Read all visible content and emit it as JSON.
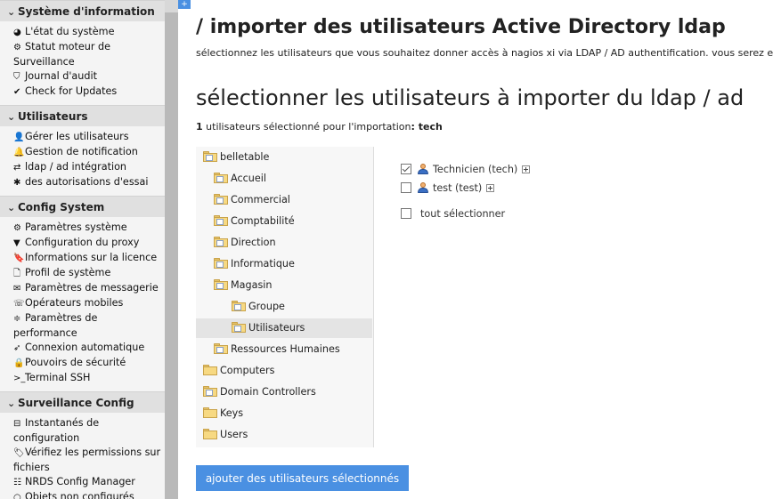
{
  "sidebar": {
    "sections": [
      {
        "title": "Système d'information",
        "items": [
          {
            "icon": "pie-chart-icon",
            "glyph": "◕",
            "label": "L'état du système"
          },
          {
            "icon": "dashboard-icon",
            "glyph": "⚙",
            "label": "Statut moteur de Surveillance"
          },
          {
            "icon": "shield-icon",
            "glyph": "⛉",
            "label": "Journal d'audit"
          },
          {
            "icon": "check-circle-icon",
            "glyph": "✔",
            "label": "Check for Updates"
          }
        ]
      },
      {
        "title": "Utilisateurs",
        "items": [
          {
            "icon": "user-icon",
            "glyph": "👤",
            "label": "Gérer les utilisateurs"
          },
          {
            "icon": "bell-icon",
            "glyph": "🔔",
            "label": "Gestion de notification"
          },
          {
            "icon": "exchange-icon",
            "glyph": "⇄",
            "label": "ldap / ad intégration"
          },
          {
            "icon": "asterisk-icon",
            "glyph": "✱",
            "label": "des autorisations d'essai"
          }
        ]
      },
      {
        "title": "Config System",
        "items": [
          {
            "icon": "cog-icon",
            "glyph": "⚙",
            "label": "Paramètres système"
          },
          {
            "icon": "filter-icon",
            "glyph": "▼",
            "label": "Configuration du proxy"
          },
          {
            "icon": "bookmark-icon",
            "glyph": "🔖",
            "label": "Informations sur la licence"
          },
          {
            "icon": "file-icon",
            "glyph": "🗋",
            "label": "Profil de système"
          },
          {
            "icon": "envelope-icon",
            "glyph": "✉",
            "label": "Paramètres de messagerie"
          },
          {
            "icon": "phone-icon",
            "glyph": "☏",
            "label": "Opérateurs mobiles"
          },
          {
            "icon": "sliders-icon",
            "glyph": "≑",
            "label": "Paramètres de performance"
          },
          {
            "icon": "paper-plane-icon",
            "glyph": "➶",
            "label": "Connexion automatique"
          },
          {
            "icon": "lock-icon",
            "glyph": "🔒",
            "label": "Pouvoirs de sécurité"
          },
          {
            "icon": "terminal-icon",
            "glyph": ">_",
            "label": "Terminal SSH"
          }
        ]
      },
      {
        "title": "Surveillance Config",
        "items": [
          {
            "icon": "hdd-icon",
            "glyph": "⊟",
            "label": "Instantanés de configuration"
          },
          {
            "icon": "tag-icon",
            "glyph": "🏷",
            "label": "Vérifiez les permissions sur fichiers"
          },
          {
            "icon": "sitemap-icon",
            "glyph": "☷",
            "label": "NRDS Config Manager"
          },
          {
            "icon": "circle-icon",
            "glyph": "○",
            "label": "Objets non configurés"
          }
        ]
      }
    ]
  },
  "main": {
    "title": "/ importer des utilisateurs Active Directory ldap",
    "description": "sélectionnez les utilisateurs que vous souhaitez donner accès à nagios xi via LDAP / AD authentification. vous serez e",
    "section_title": "sélectionner les utilisateurs à importer du ldap / ad",
    "selected_count": "1",
    "selected_text": " utilisateurs sélectionné pour l'importation",
    "selected_sep": ": ",
    "selected_names": "tech",
    "tree": [
      {
        "label": "belletable",
        "depth": 0,
        "selected": false
      },
      {
        "label": "Accueil",
        "depth": 1,
        "selected": false
      },
      {
        "label": "Commercial",
        "depth": 1,
        "selected": false
      },
      {
        "label": "Comptabilité",
        "depth": 1,
        "selected": false
      },
      {
        "label": "Direction",
        "depth": 1,
        "selected": false
      },
      {
        "label": "Informatique",
        "depth": 1,
        "selected": false
      },
      {
        "label": "Magasin",
        "depth": 1,
        "selected": false
      },
      {
        "label": "Groupe",
        "depth": 2,
        "selected": false
      },
      {
        "label": "Utilisateurs",
        "depth": 2,
        "selected": true
      },
      {
        "label": "Ressources Humaines",
        "depth": 1,
        "selected": false
      },
      {
        "label": "Computers",
        "depth": 0,
        "selected": false
      },
      {
        "label": "Domain Controllers",
        "depth": 0,
        "selected": false
      },
      {
        "label": "Keys",
        "depth": 0,
        "selected": false
      },
      {
        "label": "Users",
        "depth": 0,
        "selected": false
      }
    ],
    "users": [
      {
        "label": "Technicien (tech)",
        "checked": true
      },
      {
        "label": "test (test)",
        "checked": false
      }
    ],
    "select_all_label": "tout sélectionner",
    "add_button_label": "ajouter des utilisateurs sélectionnés"
  },
  "colors": {
    "accent": "#4a90e2",
    "sidebar_bg": "#f4f4f4",
    "section_bg": "#e0e0e0"
  }
}
